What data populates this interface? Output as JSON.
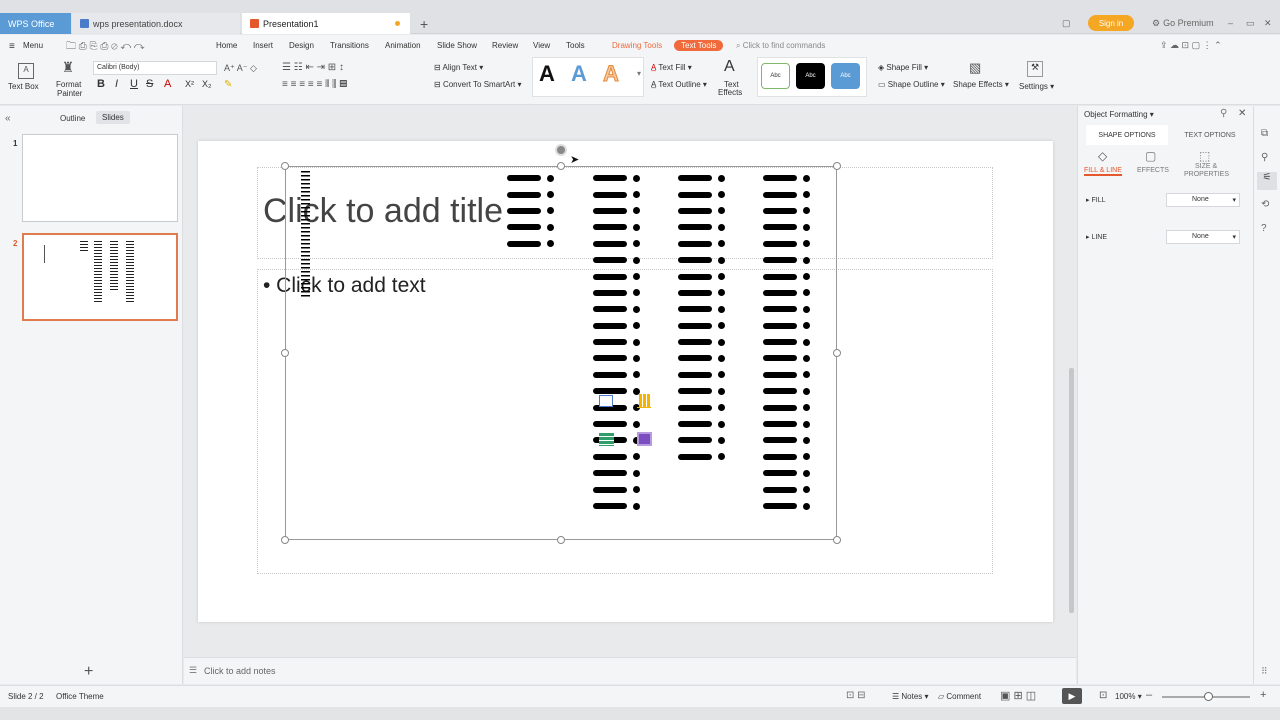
{
  "titlebar": {
    "tabs": [
      {
        "label": "WPS Office"
      },
      {
        "label": "wps presentation.docx"
      },
      {
        "label": "Presentation1"
      }
    ],
    "new_tab": "+",
    "sign_in": "Sign in",
    "go_premium": "Go Premium"
  },
  "menu": {
    "menu_label": "Menu",
    "items": [
      "Home",
      "Insert",
      "Design",
      "Transitions",
      "Animation",
      "Slide Show",
      "Review",
      "View",
      "Tools"
    ],
    "drawing_tools": "Drawing Tools",
    "text_tools": "Text Tools",
    "search_placeholder": "Click to find commands"
  },
  "ribbon": {
    "text_box": "Text Box",
    "format_painter_1": "Format",
    "format_painter_2": "Painter",
    "font_name": "Calibri (Body)",
    "align_text": "Align Text",
    "convert_smartart": "Convert To SmartArt",
    "text_fill": "Text Fill",
    "text_outline": "Text Outline",
    "text_effects_1": "Text",
    "text_effects_2": "Effects",
    "shape_style_1": "Abc",
    "shape_style_2": "Abc",
    "shape_style_3": "Abc",
    "shape_fill": "Shape Fill",
    "shape_outline": "Shape Outline",
    "shape_effects": "Shape Effects",
    "settings": "Settings"
  },
  "leftpanel": {
    "tab_outline": "Outline",
    "tab_slides": "Slides",
    "slide_numbers": [
      "1",
      "2"
    ],
    "add_slide": "+"
  },
  "slide": {
    "title_placeholder": "Click to add title",
    "body_placeholder": "• Click to add text"
  },
  "rightpanel": {
    "title": "Object Formatting",
    "tab_shape": "SHAPE OPTIONS",
    "tab_text": "TEXT OPTIONS",
    "sub_fill_line": "FILL & LINE",
    "sub_effects": "EFFECTS",
    "sub_size_1": "SIZE &",
    "sub_size_2": "PROPERTIES",
    "fill_label": "FILL",
    "fill_value": "None",
    "line_label": "LINE",
    "line_value": "None"
  },
  "notes": {
    "placeholder": "Click to add notes"
  },
  "status": {
    "slide_index": "Slide 2 / 2",
    "theme": "Office Theme",
    "notes": "Notes",
    "comment": "Comment",
    "zoom": "100%"
  },
  "colors": {
    "accent": "#f06a3c",
    "wps_blue": "#5b9bd5",
    "sign_in": "#f5a623"
  }
}
